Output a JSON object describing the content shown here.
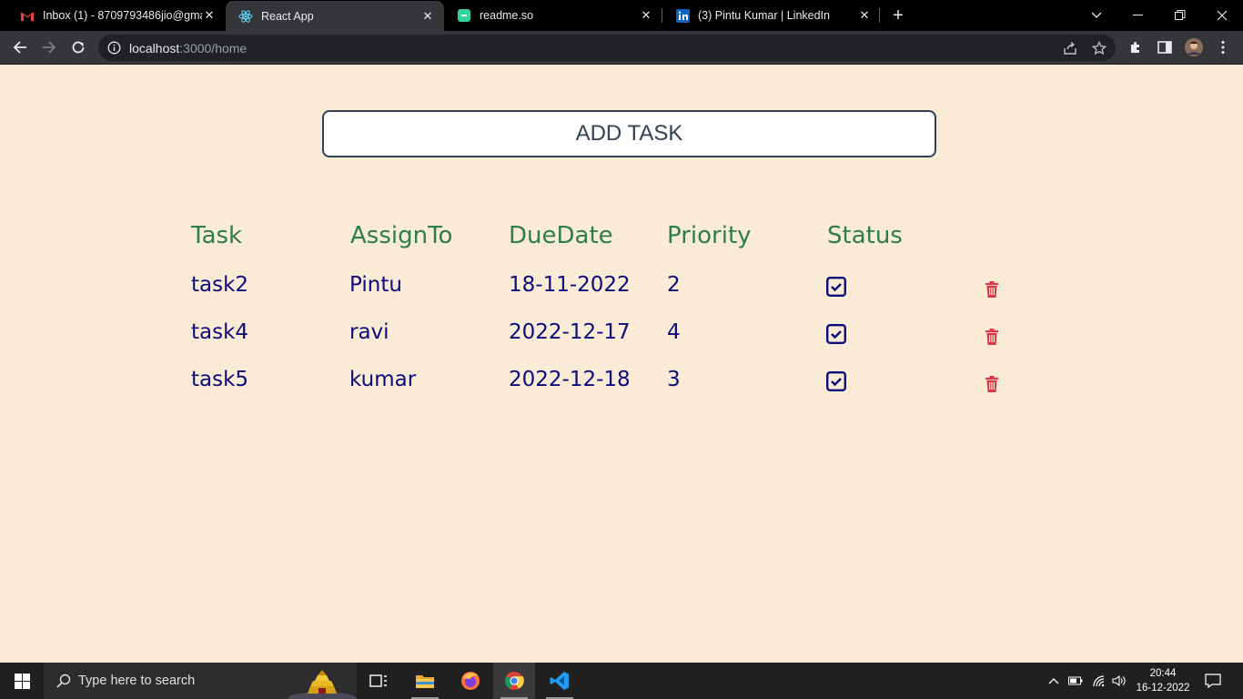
{
  "browser": {
    "tabs": [
      {
        "title": "Inbox (1) - 8709793486jio@gmai",
        "favicon": "gmail-icon",
        "active": false
      },
      {
        "title": "React App",
        "favicon": "react-icon",
        "active": true
      },
      {
        "title": "readme.so",
        "favicon": "readme-icon",
        "active": false
      },
      {
        "title": "(3) Pintu Kumar | LinkedIn",
        "favicon": "linkedin-icon",
        "active": false
      }
    ],
    "close_glyph": "✕",
    "new_tab_glyph": "+",
    "url_host": "localhost",
    "url_rest": ":3000/home"
  },
  "page": {
    "add_task_label": "ADD TASK",
    "columns": [
      "Task",
      "AssignTo",
      "DueDate",
      "Priority",
      "Status"
    ],
    "rows": [
      {
        "task": "task2",
        "assign_to": "Pintu",
        "due_date": "18-11-2022",
        "priority": "2",
        "status_checked": true
      },
      {
        "task": "task4",
        "assign_to": "ravi",
        "due_date": "2022-12-17",
        "priority": "4",
        "status_checked": true
      },
      {
        "task": "task5",
        "assign_to": "kumar",
        "due_date": "2022-12-18",
        "priority": "3",
        "status_checked": true
      }
    ]
  },
  "taskbar": {
    "search_placeholder": "Type here to search",
    "time": "20:44",
    "date": "16-12-2022"
  },
  "colors": {
    "page_background": "#faebd7",
    "header_text": "#2e7d4f",
    "cell_text": "#0b0b7a",
    "delete_icon": "#dc3545"
  }
}
